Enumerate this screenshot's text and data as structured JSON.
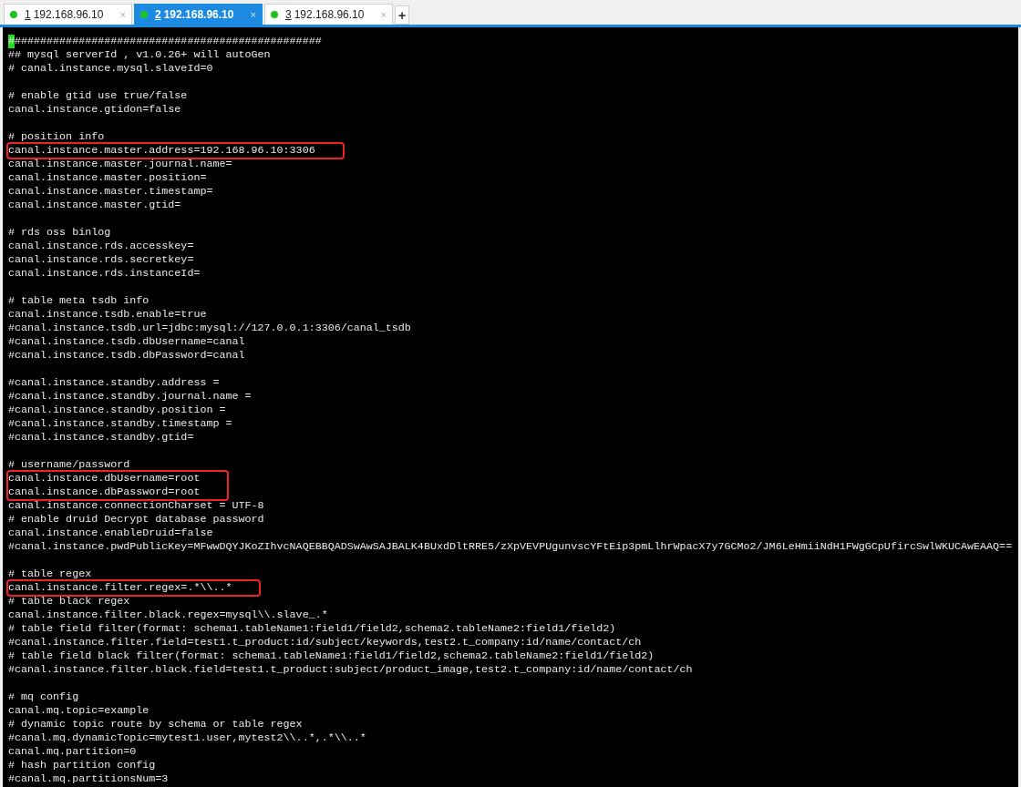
{
  "tabs": [
    {
      "number": "1",
      "label": "192.168.96.10",
      "close": "×",
      "selected": false
    },
    {
      "number": "2",
      "label": "192.168.96.10",
      "close": "×",
      "selected": true
    },
    {
      "number": "3",
      "label": "192.168.96.10",
      "close": "×",
      "selected": false
    }
  ],
  "new_tab": "+",
  "lines": [
    {
      "kind": "text",
      "text": "#################################################",
      "highlighted": false,
      "cursor": true
    },
    {
      "kind": "text",
      "text": "## mysql serverId , v1.0.26+ will autoGen",
      "highlighted": false
    },
    {
      "kind": "text",
      "text": "# canal.instance.mysql.slaveId=0",
      "highlighted": false
    },
    {
      "kind": "blank"
    },
    {
      "kind": "text",
      "text": "# enable gtid use true/false",
      "highlighted": false
    },
    {
      "kind": "text",
      "text": "canal.instance.gtidon=false",
      "highlighted": false
    },
    {
      "kind": "blank"
    },
    {
      "kind": "text",
      "text": "# position info",
      "highlighted": false
    },
    {
      "kind": "text",
      "text": "canal.instance.master.address=192.168.96.10:3306",
      "highlighted": true
    },
    {
      "kind": "text",
      "text": "canal.instance.master.journal.name=",
      "highlighted": false
    },
    {
      "kind": "text",
      "text": "canal.instance.master.position=",
      "highlighted": false
    },
    {
      "kind": "text",
      "text": "canal.instance.master.timestamp=",
      "highlighted": false
    },
    {
      "kind": "text",
      "text": "canal.instance.master.gtid=",
      "highlighted": false
    },
    {
      "kind": "blank"
    },
    {
      "kind": "text",
      "text": "# rds oss binlog",
      "highlighted": false
    },
    {
      "kind": "text",
      "text": "canal.instance.rds.accesskey=",
      "highlighted": false
    },
    {
      "kind": "text",
      "text": "canal.instance.rds.secretkey=",
      "highlighted": false
    },
    {
      "kind": "text",
      "text": "canal.instance.rds.instanceId=",
      "highlighted": false
    },
    {
      "kind": "blank"
    },
    {
      "kind": "text",
      "text": "# table meta tsdb info",
      "highlighted": false
    },
    {
      "kind": "text",
      "text": "canal.instance.tsdb.enable=true",
      "highlighted": false
    },
    {
      "kind": "text",
      "text": "#canal.instance.tsdb.url=jdbc:mysql://127.0.0.1:3306/canal_tsdb",
      "highlighted": false
    },
    {
      "kind": "text",
      "text": "#canal.instance.tsdb.dbUsername=canal",
      "highlighted": false
    },
    {
      "kind": "text",
      "text": "#canal.instance.tsdb.dbPassword=canal",
      "highlighted": false
    },
    {
      "kind": "blank"
    },
    {
      "kind": "text",
      "text": "#canal.instance.standby.address =",
      "highlighted": false
    },
    {
      "kind": "text",
      "text": "#canal.instance.standby.journal.name =",
      "highlighted": false
    },
    {
      "kind": "text",
      "text": "#canal.instance.standby.position =",
      "highlighted": false
    },
    {
      "kind": "text",
      "text": "#canal.instance.standby.timestamp =",
      "highlighted": false
    },
    {
      "kind": "text",
      "text": "#canal.instance.standby.gtid=",
      "highlighted": false
    },
    {
      "kind": "blank"
    },
    {
      "kind": "text",
      "text": "# username/password",
      "highlighted": false
    },
    {
      "kind": "text",
      "text": "canal.instance.dbUsername=root",
      "highlighted": true
    },
    {
      "kind": "text",
      "text": "canal.instance.dbPassword=root",
      "highlighted": true
    },
    {
      "kind": "text",
      "text": "canal.instance.connectionCharset = UTF-8",
      "highlighted": false
    },
    {
      "kind": "text",
      "text": "# enable druid Decrypt database password",
      "highlighted": false
    },
    {
      "kind": "text",
      "text": "canal.instance.enableDruid=false",
      "highlighted": false
    },
    {
      "kind": "text",
      "text": "#canal.instance.pwdPublicKey=MFwwDQYJKoZIhvcNAQEBBQADSwAwSAJBALK4BUxdDltRRE5/zXpVEVPUgunvscYFtEip3pmLlhrWpacX7y7GCMo2/JM6LeHmiiNdH1FWgGCpUfircSwlWKUCAwEAAQ==",
      "highlighted": false
    },
    {
      "kind": "blank"
    },
    {
      "kind": "text",
      "text": "# table regex",
      "highlighted": false
    },
    {
      "kind": "text",
      "text": "canal.instance.filter.regex=.*\\\\..*",
      "highlighted": true
    },
    {
      "kind": "text",
      "text": "# table black regex",
      "highlighted": false
    },
    {
      "kind": "text",
      "text": "canal.instance.filter.black.regex=mysql\\\\.slave_.*",
      "highlighted": false
    },
    {
      "kind": "text",
      "text": "# table field filter(format: schema1.tableName1:field1/field2,schema2.tableName2:field1/field2)",
      "highlighted": false
    },
    {
      "kind": "text",
      "text": "#canal.instance.filter.field=test1.t_product:id/subject/keywords,test2.t_company:id/name/contact/ch",
      "highlighted": false
    },
    {
      "kind": "text",
      "text": "# table field black filter(format: schema1.tableName1:field1/field2,schema2.tableName2:field1/field2)",
      "highlighted": false
    },
    {
      "kind": "text",
      "text": "#canal.instance.filter.black.field=test1.t_product:subject/product_image,test2.t_company:id/name/contact/ch",
      "highlighted": false
    },
    {
      "kind": "blank"
    },
    {
      "kind": "text",
      "text": "# mq config",
      "highlighted": false
    },
    {
      "kind": "text",
      "text": "canal.mq.topic=example",
      "highlighted": false
    },
    {
      "kind": "text",
      "text": "# dynamic topic route by schema or table regex",
      "highlighted": false
    },
    {
      "kind": "text",
      "text": "#canal.mq.dynamicTopic=mytest1.user,mytest2\\\\..*,.*\\\\..*",
      "highlighted": false
    },
    {
      "kind": "text",
      "text": "canal.mq.partition=0",
      "highlighted": false
    },
    {
      "kind": "text",
      "text": "# hash partition config",
      "highlighted": false
    },
    {
      "kind": "text",
      "text": "#canal.mq.partitionsNum=3",
      "highlighted": false
    }
  ]
}
